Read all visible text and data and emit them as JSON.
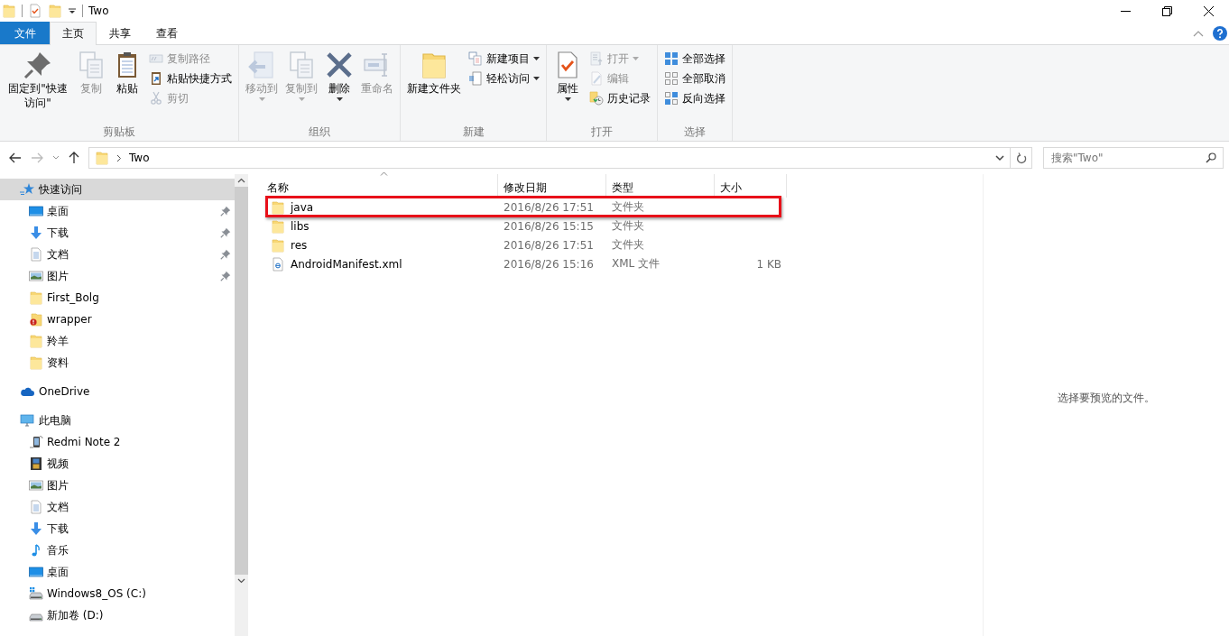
{
  "window": {
    "title": "Two"
  },
  "ribbon_tabs": [
    {
      "label": "文件",
      "kind": "menu",
      "selected": false
    },
    {
      "label": "主页",
      "kind": "tab",
      "selected": true
    },
    {
      "label": "共享",
      "kind": "tab",
      "selected": false
    },
    {
      "label": "查看",
      "kind": "tab",
      "selected": false
    }
  ],
  "ribbon": {
    "groups": [
      {
        "label": "剪贴板",
        "items": [
          {
            "label": "固定到\"快速访问\"",
            "kind": "large",
            "disabled": false,
            "dropdown": false
          },
          {
            "label": "复制",
            "kind": "large",
            "disabled": true,
            "dropdown": false
          },
          {
            "label": "粘贴",
            "kind": "large",
            "disabled": false,
            "dropdown": false
          },
          {
            "label": "复制路径",
            "kind": "small",
            "disabled": true,
            "dropdown": false
          },
          {
            "label": "粘贴快捷方式",
            "kind": "small",
            "disabled": false,
            "dropdown": false
          },
          {
            "label": "剪切",
            "kind": "small",
            "disabled": true,
            "dropdown": false
          }
        ]
      },
      {
        "label": "组织",
        "items": [
          {
            "label": "移动到",
            "kind": "large",
            "disabled": true,
            "dropdown": true
          },
          {
            "label": "复制到",
            "kind": "large",
            "disabled": true,
            "dropdown": true
          },
          {
            "label": "删除",
            "kind": "large",
            "disabled": false,
            "dropdown": true
          },
          {
            "label": "重命名",
            "kind": "large",
            "disabled": true,
            "dropdown": false
          }
        ]
      },
      {
        "label": "新建",
        "items": [
          {
            "label": "新建文件夹",
            "kind": "large",
            "disabled": false,
            "dropdown": false
          },
          {
            "label": "新建项目",
            "kind": "small",
            "disabled": false,
            "dropdown": true
          },
          {
            "label": "轻松访问",
            "kind": "small",
            "disabled": false,
            "dropdown": true
          }
        ]
      },
      {
        "label": "打开",
        "items": [
          {
            "label": "属性",
            "kind": "large",
            "disabled": false,
            "dropdown": true
          },
          {
            "label": "打开",
            "kind": "small",
            "disabled": true,
            "dropdown": true
          },
          {
            "label": "编辑",
            "kind": "small",
            "disabled": true,
            "dropdown": false
          },
          {
            "label": "历史记录",
            "kind": "small",
            "disabled": false,
            "dropdown": false
          }
        ]
      },
      {
        "label": "选择",
        "items": [
          {
            "label": "全部选择",
            "kind": "small",
            "disabled": false,
            "dropdown": false
          },
          {
            "label": "全部取消",
            "kind": "small",
            "disabled": false,
            "dropdown": false
          },
          {
            "label": "反向选择",
            "kind": "small",
            "disabled": false,
            "dropdown": false
          }
        ]
      }
    ]
  },
  "address": {
    "path": [
      "Two"
    ]
  },
  "search": {
    "placeholder": "搜索\"Two\""
  },
  "nav": [
    {
      "label": "快速访问",
      "kind": "star",
      "selected": true,
      "children": [
        {
          "label": "桌面",
          "kind": "desktop",
          "selected": false,
          "pinned": true
        },
        {
          "label": "下载",
          "kind": "download",
          "selected": false,
          "pinned": true
        },
        {
          "label": "文档",
          "kind": "document",
          "selected": false,
          "pinned": true
        },
        {
          "label": "图片",
          "kind": "picture",
          "selected": false,
          "pinned": true
        },
        {
          "label": "First_Bolg",
          "kind": "folder",
          "selected": false,
          "pinned": false
        },
        {
          "label": "wrapper",
          "kind": "folder-error",
          "selected": false,
          "pinned": false
        },
        {
          "label": "羚羊",
          "kind": "folder",
          "selected": false,
          "pinned": false
        },
        {
          "label": "资料",
          "kind": "folder",
          "selected": false,
          "pinned": false
        }
      ]
    },
    {
      "label": "OneDrive",
      "kind": "cloud",
      "selected": false
    },
    {
      "label": "此电脑",
      "kind": "pc",
      "selected": false,
      "children": [
        {
          "label": "Redmi Note 2",
          "kind": "phone",
          "selected": false
        },
        {
          "label": "视频",
          "kind": "video",
          "selected": false
        },
        {
          "label": "图片",
          "kind": "picture",
          "selected": false
        },
        {
          "label": "文档",
          "kind": "document",
          "selected": false
        },
        {
          "label": "下载",
          "kind": "download",
          "selected": false
        },
        {
          "label": "音乐",
          "kind": "music",
          "selected": false
        },
        {
          "label": "桌面",
          "kind": "desktop",
          "selected": false
        },
        {
          "label": "Windows8_OS (C:)",
          "kind": "drive-win",
          "selected": false
        },
        {
          "label": "新加卷 (D:)",
          "kind": "drive",
          "selected": false
        }
      ]
    }
  ],
  "columns": [
    {
      "label": "名称",
      "sorted": true
    },
    {
      "label": "修改日期",
      "sorted": false
    },
    {
      "label": "类型",
      "sorted": false
    },
    {
      "label": "大小",
      "sorted": false
    }
  ],
  "files": [
    {
      "name": "java",
      "kind": "folder",
      "modified": "2016/8/26 17:51",
      "type": "文件夹",
      "highlighted": true
    },
    {
      "name": "libs",
      "kind": "folder",
      "modified": "2016/8/26 15:15",
      "type": "文件夹",
      "highlighted": false
    },
    {
      "name": "res",
      "kind": "folder",
      "modified": "2016/8/26 17:51",
      "type": "文件夹",
      "highlighted": false
    },
    {
      "name": "AndroidManifest.xml",
      "kind": "xml",
      "modified": "2016/8/26 15:16",
      "type": "XML 文件",
      "size": "1 KB",
      "highlighted": false
    }
  ],
  "preview": {
    "message": "选择要预览的文件。"
  }
}
